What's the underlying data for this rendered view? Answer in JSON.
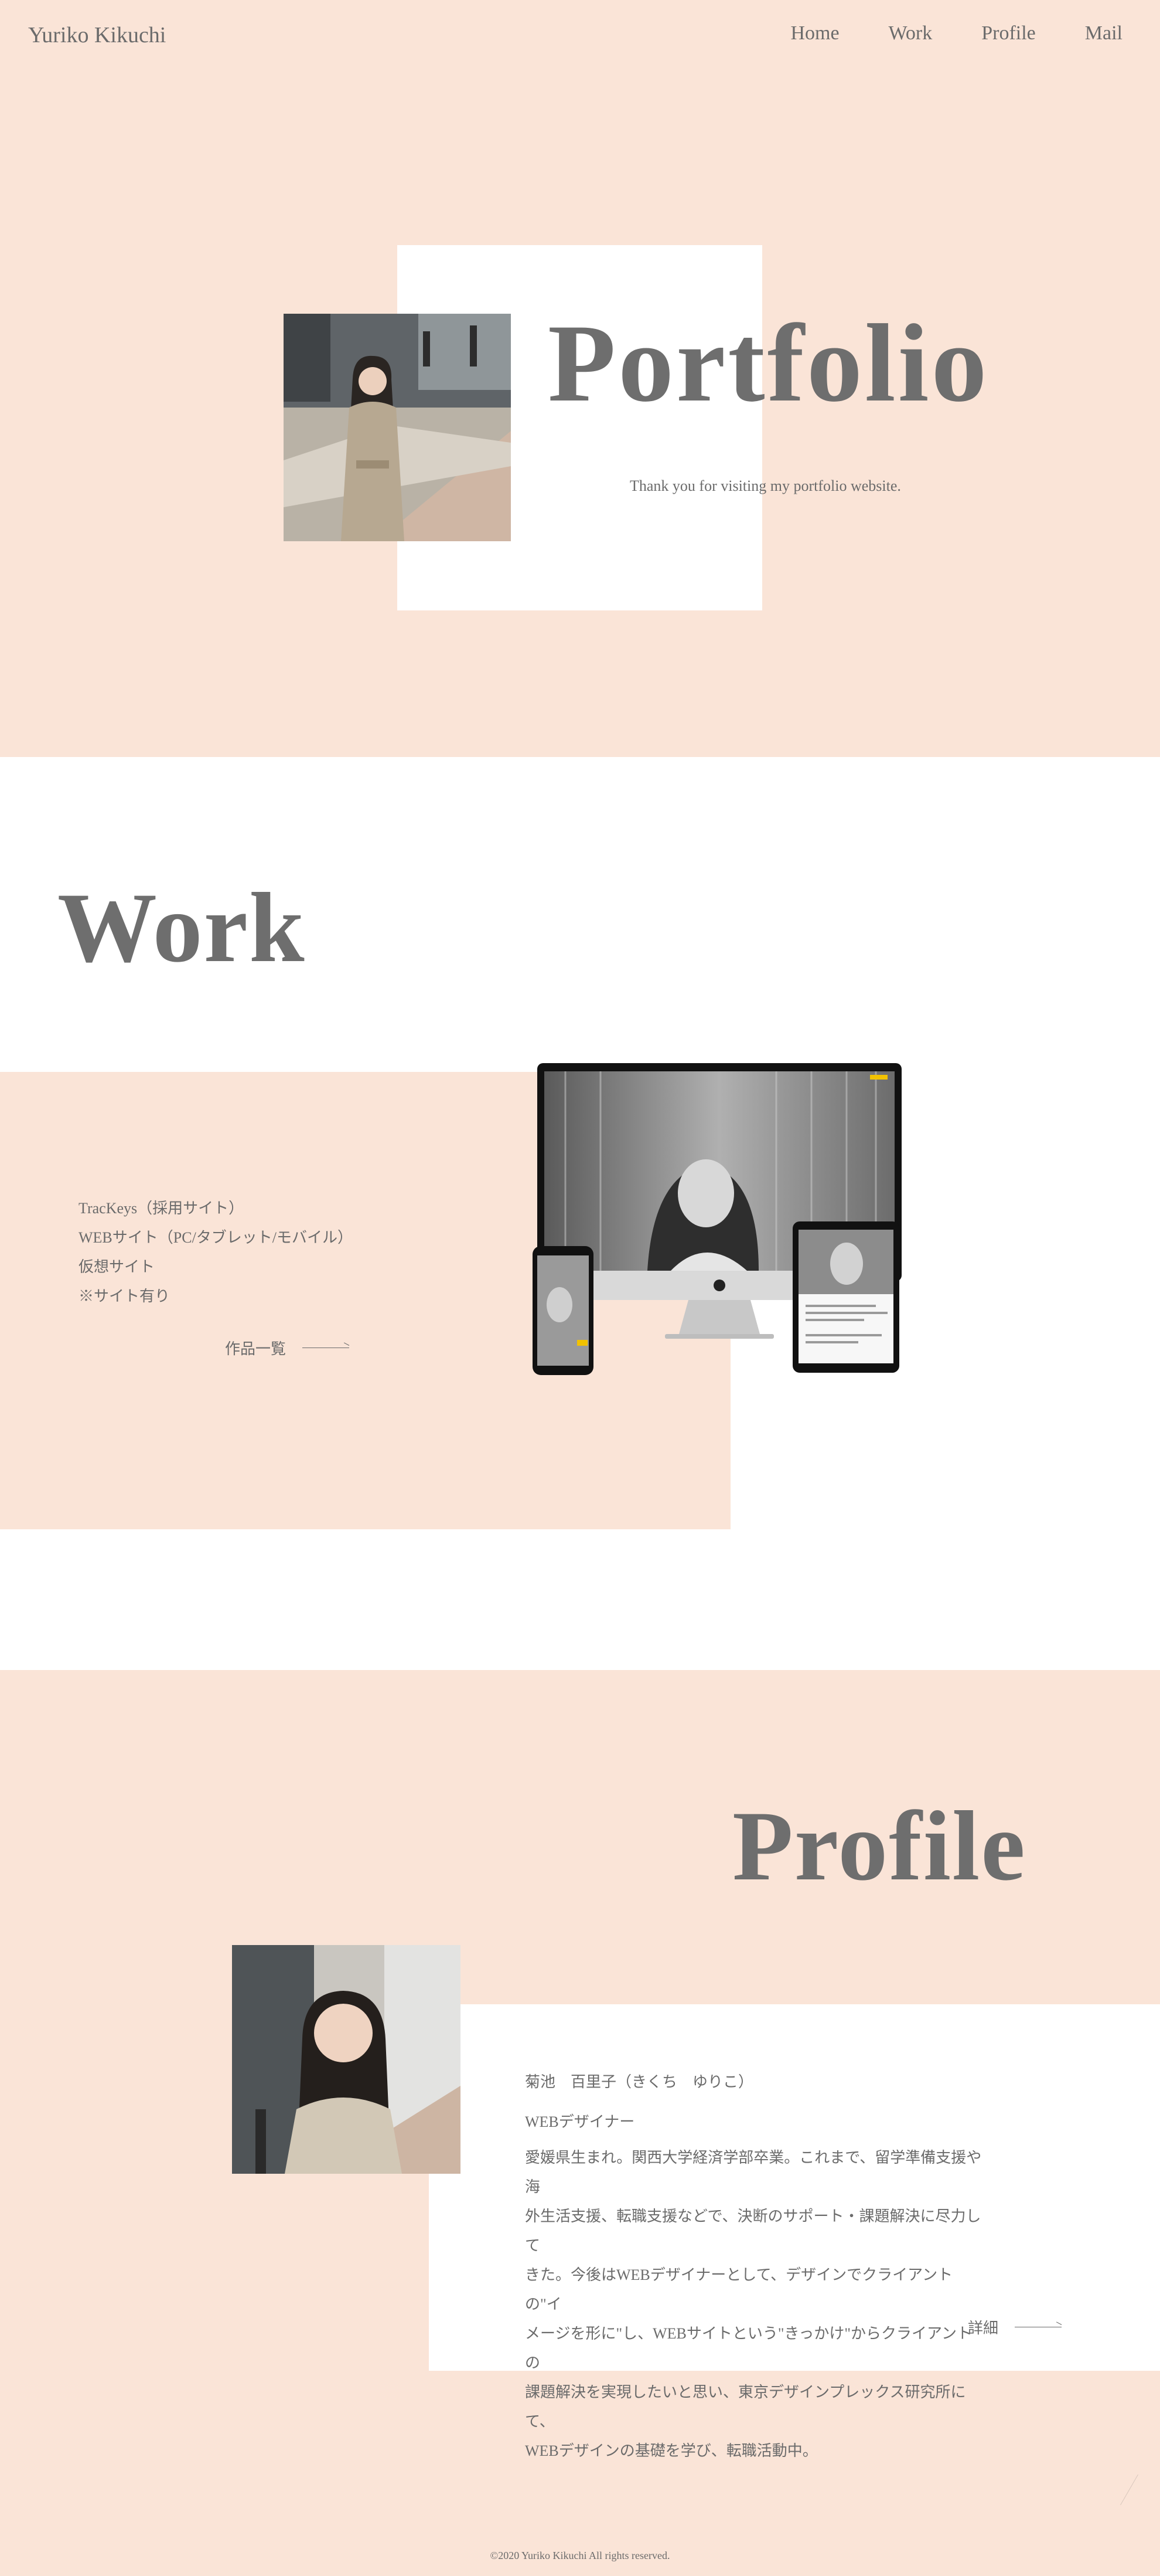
{
  "header": {
    "logo": "Yuriko Kikuchi",
    "nav": [
      {
        "label": "Home"
      },
      {
        "label": "Work"
      },
      {
        "label": "Profile"
      },
      {
        "label": "Mail"
      }
    ]
  },
  "hero": {
    "title": "Portfolio",
    "subtitle": "Thank you for visiting my portfolio website."
  },
  "work": {
    "title": "Work",
    "items": [
      "TracKeys（採用サイト）",
      "WEBサイト（PC/タブレット/モバイル）",
      "仮想サイト",
      "※サイト有り"
    ],
    "more_label": "作品一覧"
  },
  "profile": {
    "title": "Profile",
    "name": "菊池　百里子（きくち　ゆりこ）",
    "job": "WEBデザイナー",
    "bio_lines": [
      "愛媛県生まれ。関西大学経済学部卒業。これまで、留学準備支援や海",
      "外生活支援、転職支援などで、決断のサポート・課題解決に尽力して",
      "きた。今後はWEBデザイナーとして、デザインでクライアントの\"イ",
      "メージを形に\"し、WEBサイトという\"きっかけ\"からクライアントの",
      "課題解決を実現したいと思い、東京デザインプレックス研究所にて、",
      "WEBデザインの基礎を学び、転職活動中。"
    ],
    "more_label": "詳細"
  },
  "footer": {
    "copyright": "©2020 Yuriko Kikuchi All rights reserved."
  },
  "colors": {
    "accent_bg": "#fae4d7",
    "text": "#6b6b6b"
  }
}
